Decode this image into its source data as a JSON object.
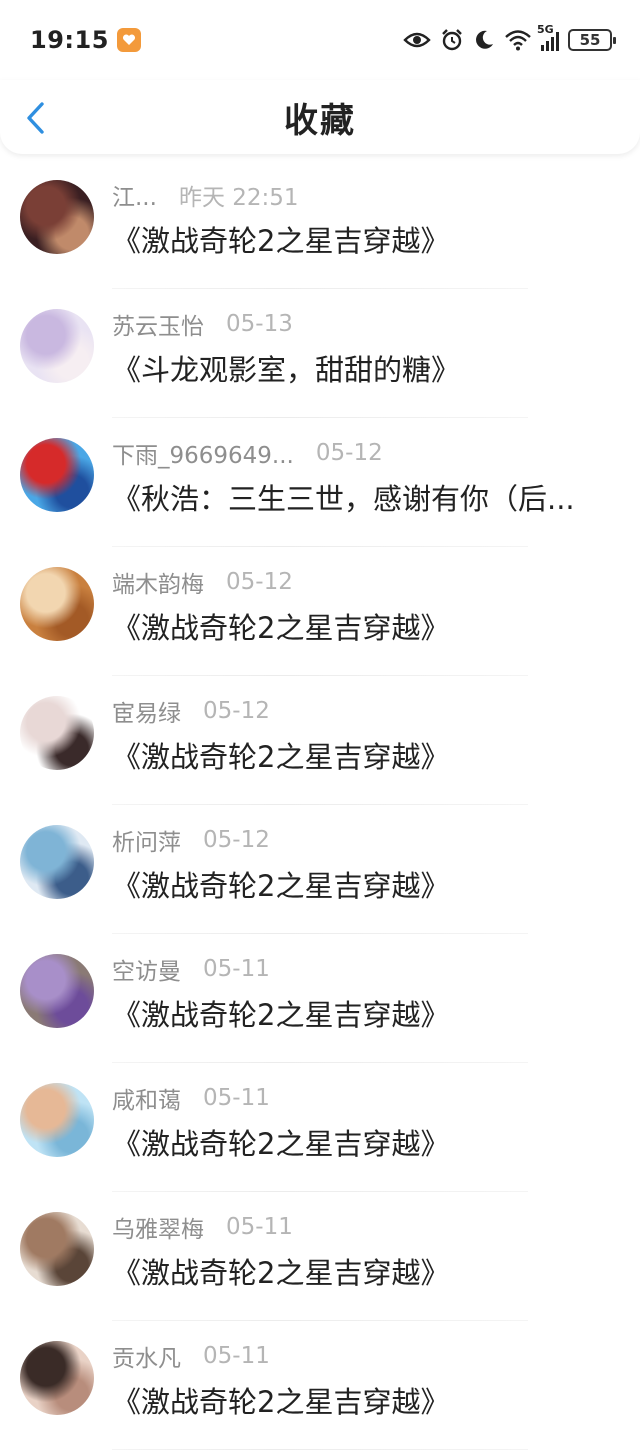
{
  "status": {
    "time": "19:15",
    "network": "5G",
    "battery": "55"
  },
  "header": {
    "title": "收藏"
  },
  "items": [
    {
      "name": "江...",
      "date": "昨天 22:51",
      "title": "《激战奇轮2之星吉穿越》",
      "avatar": [
        "#3a1f22",
        "#7a3f36",
        "#c08a6a"
      ]
    },
    {
      "name": "苏云玉怡",
      "date": "05-13",
      "title": "《斗龙观影室，甜甜的糖》",
      "avatar": [
        "#e9e3f3",
        "#c9b8e0",
        "#f6eef2"
      ]
    },
    {
      "name": "下雨_9669649...",
      "date": "05-12",
      "title": "《秋浩：三生三世，感谢有你（后...",
      "avatar": [
        "#4aa7e6",
        "#d62a2a",
        "#1f4f9e"
      ]
    },
    {
      "name": "端木韵梅",
      "date": "05-12",
      "title": "《激战奇轮2之星吉穿越》",
      "avatar": [
        "#c9803f",
        "#f2d6b0",
        "#a35a26"
      ]
    },
    {
      "name": "宦易绿",
      "date": "05-12",
      "title": "《激战奇轮2之星吉穿越》",
      "avatar": [
        "#ffffff",
        "#e8d8d6",
        "#3a2a2a"
      ]
    },
    {
      "name": "析问萍",
      "date": "05-12",
      "title": "《激战奇轮2之星吉穿越》",
      "avatar": [
        "#dfe9f3",
        "#7fb4d6",
        "#3c5d8a"
      ]
    },
    {
      "name": "空访曼",
      "date": "05-11",
      "title": "《激战奇轮2之星吉穿越》",
      "avatar": [
        "#8a7a75",
        "#a88fc9",
        "#6d4c9a"
      ]
    },
    {
      "name": "咸和蔼",
      "date": "05-11",
      "title": "《激战奇轮2之星吉穿越》",
      "avatar": [
        "#bfe3f5",
        "#e6b896",
        "#7ab6d8"
      ]
    },
    {
      "name": "乌雅翠梅",
      "date": "05-11",
      "title": "《激战奇轮2之星吉穿越》",
      "avatar": [
        "#e7dcd2",
        "#a07a62",
        "#5a4538"
      ]
    },
    {
      "name": "贡水凡",
      "date": "05-11",
      "title": "《激战奇轮2之星吉穿越》",
      "avatar": [
        "#e9d2c6",
        "#3a2b27",
        "#b88d7c"
      ]
    }
  ],
  "colors": {
    "accent": "#2f8fe0",
    "meta": "#9a9a9a",
    "text": "#222222"
  }
}
